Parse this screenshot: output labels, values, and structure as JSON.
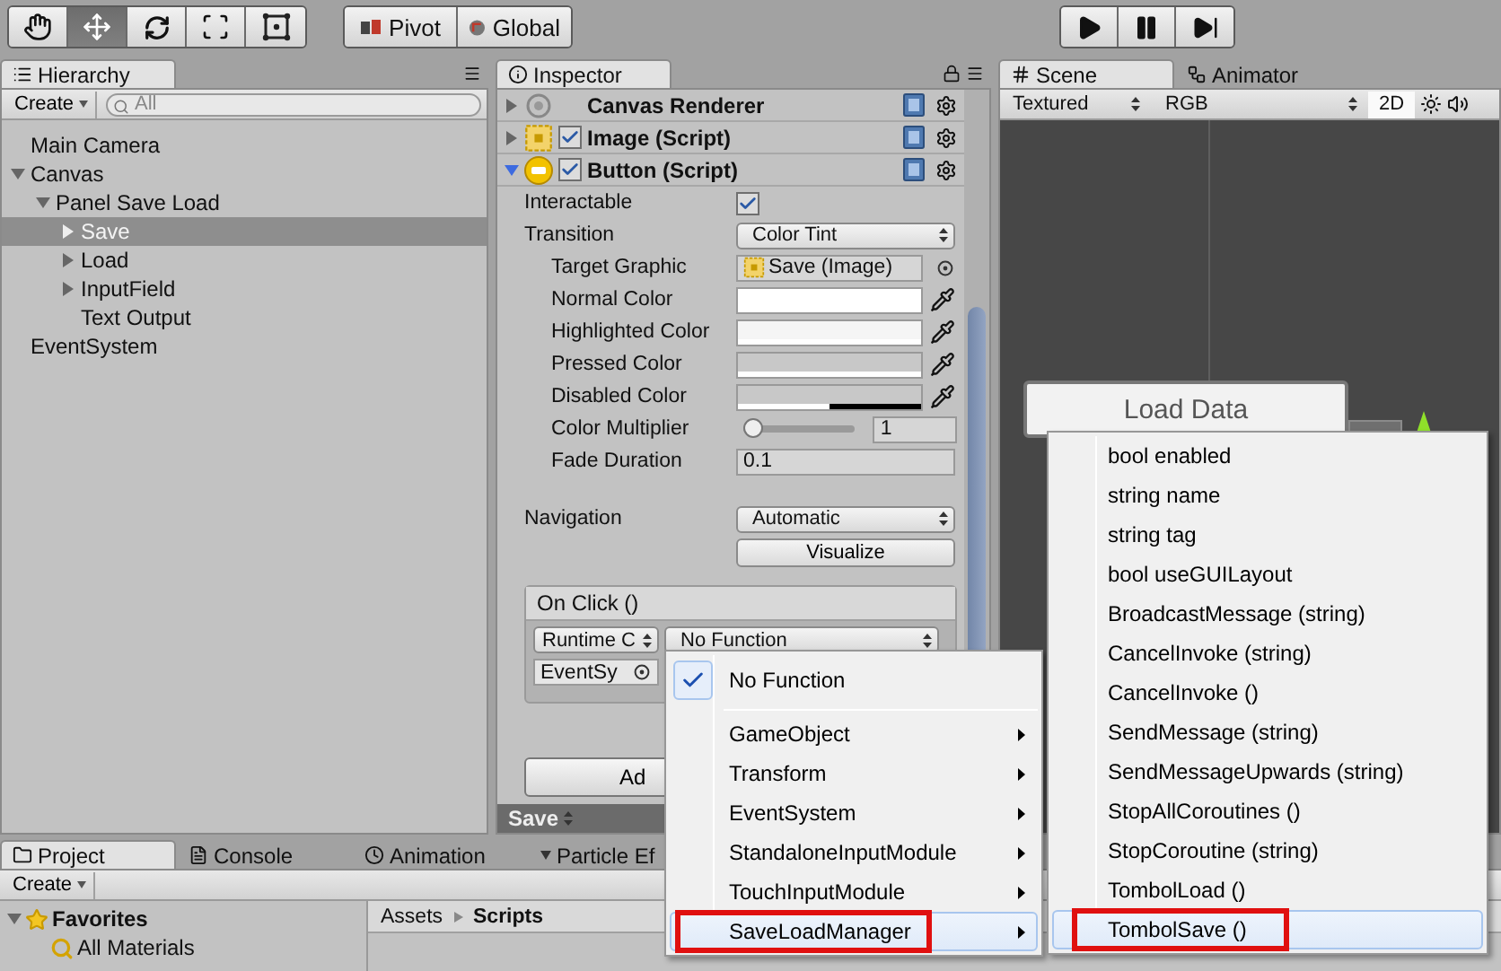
{
  "toolbar": {
    "tools": [
      {
        "kind": "hand",
        "selected": false
      },
      {
        "kind": "move",
        "selected": true
      },
      {
        "kind": "rotate",
        "selected": false
      },
      {
        "kind": "scale",
        "selected": false
      },
      {
        "kind": "rect",
        "selected": false
      }
    ],
    "pivot_buttons": [
      {
        "kind": "pivot",
        "label": "Pivot"
      },
      {
        "kind": "global",
        "label": "Global"
      }
    ],
    "play_controls": [
      {
        "kind": "play",
        "selected": false
      },
      {
        "kind": "pause",
        "selected": false
      },
      {
        "kind": "step",
        "selected": false
      }
    ]
  },
  "hierarchy": {
    "tab": "Hierarchy",
    "create": "Create",
    "search_placeholder": "All",
    "items": [
      {
        "label": "Main Camera",
        "selected": false
      },
      {
        "label": "Canvas",
        "expanded": true,
        "selected": false,
        "children": [
          {
            "label": "Panel Save Load",
            "expanded": true,
            "selected": false,
            "children": [
              {
                "label": "Save",
                "expanded": false,
                "selected": true
              },
              {
                "label": "Load",
                "expanded": false,
                "selected": false
              },
              {
                "label": "InputField",
                "expanded": false,
                "selected": false
              },
              {
                "label": "Text Output",
                "selected": false
              }
            ]
          }
        ]
      },
      {
        "label": "EventSystem",
        "selected": false
      }
    ]
  },
  "inspector": {
    "tab": "Inspector",
    "components": [
      {
        "kind": "renderer",
        "name": "Canvas Renderer",
        "expanded": false
      },
      {
        "kind": "image",
        "name": "Image (Script)",
        "expanded": false,
        "enabled": true
      },
      {
        "kind": "button",
        "name": "Button (Script)",
        "expanded": true,
        "enabled": true
      }
    ],
    "properties": [
      {
        "kind": "checkbox",
        "label": "Interactable",
        "checked": true
      },
      {
        "kind": "dropdown",
        "label": "Transition",
        "value": "Color Tint",
        "children": [
          {
            "kind": "object",
            "label": "Target Graphic",
            "value": "Save (Image)"
          },
          {
            "kind": "color",
            "label": "Normal Color",
            "color": "#ffffff",
            "level": 1
          },
          {
            "kind": "color",
            "label": "Highlighted Color",
            "color": "#f5f5f5",
            "level": 1
          },
          {
            "kind": "color",
            "label": "Pressed Color",
            "color": "#c8c8c8",
            "level": 1
          },
          {
            "kind": "color",
            "label": "Disabled Color",
            "color": "#c8c8c8",
            "level": 0.5
          },
          {
            "kind": "slider",
            "label": "Color Multiplier",
            "value": "1",
            "level": 0
          },
          {
            "kind": "number",
            "label": "Fade Duration",
            "value": "0.1"
          }
        ]
      }
    ],
    "navigation": {
      "label": "Navigation",
      "value": "Automatic",
      "button": "Visualize"
    },
    "on_click": {
      "title": "On Click ()",
      "runtime": "Runtime C",
      "function": "No Function",
      "target": "EventSy"
    },
    "add_button": "Ad",
    "preview": "Save"
  },
  "scene": {
    "tabs": [
      {
        "kind": "scene",
        "label": "Scene",
        "selected": true
      },
      {
        "kind": "animator",
        "label": "Animator",
        "selected": false
      }
    ],
    "shading": "Textured",
    "channel": "RGB",
    "mode_2d": {
      "label": "2D",
      "on": true
    },
    "scene_button": "Load Data"
  },
  "project": {
    "tabs": [
      {
        "kind": "project",
        "label": "Project",
        "selected": true
      },
      {
        "kind": "console",
        "label": "Console",
        "selected": false
      },
      {
        "kind": "animation",
        "label": "Animation",
        "selected": false
      },
      {
        "kind": "particle",
        "label": "Particle Ef",
        "selected": false
      }
    ],
    "create": "Create",
    "favorites": {
      "label": "Favorites",
      "expanded": true,
      "items": [
        "All Materials"
      ]
    },
    "breadcrumb": [
      "Assets",
      "Scripts"
    ]
  },
  "function_menu": {
    "items": [
      {
        "kind": "check",
        "label": "No Function",
        "checked": true,
        "highlighted": false,
        "marked": false
      },
      {
        "kind": "separator"
      },
      {
        "kind": "submenu",
        "label": "GameObject",
        "highlighted": false,
        "marked": false
      },
      {
        "kind": "submenu",
        "label": "Transform",
        "highlighted": false,
        "marked": false
      },
      {
        "kind": "submenu",
        "label": "EventSystem",
        "highlighted": false,
        "marked": false
      },
      {
        "kind": "submenu",
        "label": "StandaloneInputModule",
        "highlighted": false,
        "marked": false
      },
      {
        "kind": "submenu",
        "label": "TouchInputModule",
        "highlighted": false,
        "marked": false
      },
      {
        "kind": "submenu",
        "label": "SaveLoadManager",
        "highlighted": true,
        "marked": true
      }
    ]
  },
  "member_menu": {
    "items": [
      {
        "label": "bool enabled",
        "highlighted": false,
        "marked": false
      },
      {
        "label": "string name",
        "highlighted": false,
        "marked": false
      },
      {
        "label": "string tag",
        "highlighted": false,
        "marked": false
      },
      {
        "label": "bool useGUILayout",
        "highlighted": false,
        "marked": false
      },
      {
        "label": "BroadcastMessage (string)",
        "highlighted": false,
        "marked": false
      },
      {
        "label": "CancelInvoke (string)",
        "highlighted": false,
        "marked": false
      },
      {
        "label": "CancelInvoke ()",
        "highlighted": false,
        "marked": false
      },
      {
        "label": "SendMessage (string)",
        "highlighted": false,
        "marked": false
      },
      {
        "label": "SendMessageUpwards (string)",
        "highlighted": false,
        "marked": false
      },
      {
        "label": "StopAllCoroutines ()",
        "highlighted": false,
        "marked": false
      },
      {
        "label": "StopCoroutine (string)",
        "highlighted": false,
        "marked": false
      },
      {
        "label": "TombolLoad ()",
        "highlighted": false,
        "marked": false
      },
      {
        "label": "TombolSave ()",
        "highlighted": true,
        "marked": true
      }
    ]
  }
}
